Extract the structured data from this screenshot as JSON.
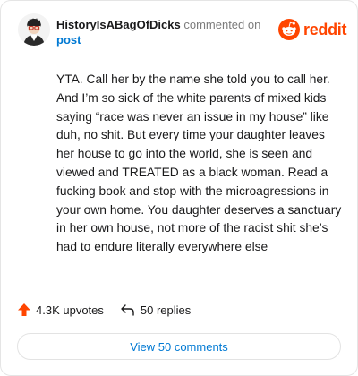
{
  "header": {
    "author": "HistoryIsABagOfDicks",
    "action_text": "commented on",
    "post_link": "post",
    "logo_text": "reddit"
  },
  "comment": {
    "body": "YTA. Call her by the name she told you to call her. And I’m so sick of the white parents of mixed kids saying “race was never an issue in my house” like duh, no shit. But every time your daughter leaves her house to go into the world, she is seen and viewed and TREATED as a black woman. Read a fucking book and stop with the microagressions in your own home. You daughter deserves a sanctuary in her own house, not more of the racist shit she’s had to endure literally everywhere else"
  },
  "stats": {
    "upvotes": "4.3K upvotes",
    "replies": "50 replies"
  },
  "footer": {
    "view_comments_label": "View 50 comments"
  },
  "icons": {
    "upvote": "upvote-arrow-icon",
    "reply": "reply-arrow-icon",
    "logo": "reddit-snoo-icon",
    "avatar": "user-avatar"
  },
  "colors": {
    "brand": "#ff4500",
    "link": "#0079d3",
    "text": "#1a1a1b",
    "muted": "#7c7c7c"
  }
}
